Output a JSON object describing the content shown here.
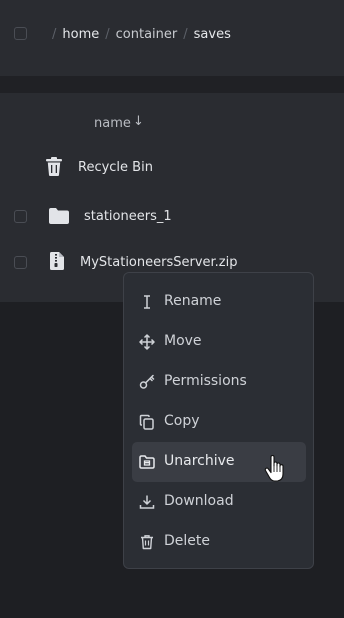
{
  "breadcrumb": {
    "segments": [
      "home",
      "container",
      "saves"
    ]
  },
  "list": {
    "column_header": "name",
    "sort_indicator": "↓",
    "items": [
      {
        "label": "Recycle Bin",
        "icon": "trash-icon"
      },
      {
        "label": "stationeers_1",
        "icon": "folder-icon"
      },
      {
        "label": "MyStationeersServer.zip",
        "icon": "zip-file-icon"
      }
    ]
  },
  "context_menu": {
    "items": [
      {
        "label": "Rename",
        "icon": "text-cursor-icon"
      },
      {
        "label": "Move",
        "icon": "move-arrows-icon"
      },
      {
        "label": "Permissions",
        "icon": "key-icon"
      },
      {
        "label": "Copy",
        "icon": "copy-icon"
      },
      {
        "label": "Unarchive",
        "icon": "unarchive-folder-icon",
        "hovered": true
      },
      {
        "label": "Download",
        "icon": "download-icon"
      },
      {
        "label": "Delete",
        "icon": "trash-icon"
      }
    ]
  },
  "colors": {
    "background": "#1e1f23",
    "panel": "#2a2c31",
    "menu": "#2b2e34",
    "highlight": "#3a3d44",
    "text": "#e3e5e8"
  }
}
